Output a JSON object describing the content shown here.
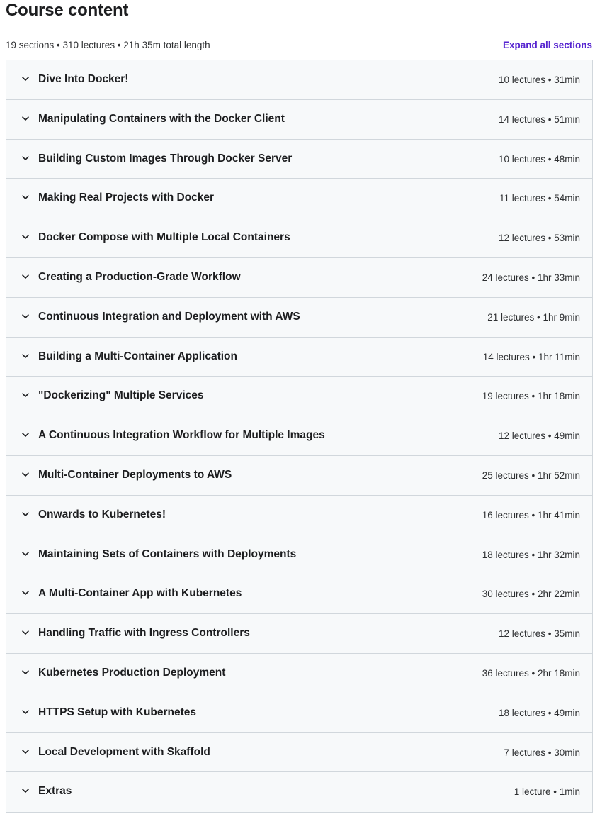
{
  "header": {
    "title": "Course content",
    "summary": "19 sections • 310 lectures • 21h 35m total length",
    "expand_label": "Expand all sections"
  },
  "icons": {
    "section_toggle": "chevron-down-icon"
  },
  "colors": {
    "accent": "#5624d0",
    "section_bg": "#f7f9fa",
    "border": "#d1d7dc",
    "text": "#1c1d1f"
  },
  "sections": [
    {
      "title": "Dive Into Docker!",
      "meta": "10 lectures • 31min"
    },
    {
      "title": "Manipulating Containers with the Docker Client",
      "meta": "14 lectures • 51min"
    },
    {
      "title": "Building Custom Images Through Docker Server",
      "meta": "10 lectures • 48min"
    },
    {
      "title": "Making Real Projects with Docker",
      "meta": "11 lectures • 54min"
    },
    {
      "title": "Docker Compose with Multiple Local Containers",
      "meta": "12 lectures • 53min"
    },
    {
      "title": "Creating a Production-Grade Workflow",
      "meta": "24 lectures • 1hr 33min"
    },
    {
      "title": "Continuous Integration and Deployment with AWS",
      "meta": "21 lectures • 1hr 9min"
    },
    {
      "title": "Building a Multi-Container Application",
      "meta": "14 lectures • 1hr 11min"
    },
    {
      "title": "\"Dockerizing\" Multiple Services",
      "meta": "19 lectures • 1hr 18min"
    },
    {
      "title": "A Continuous Integration Workflow for Multiple Images",
      "meta": "12 lectures • 49min"
    },
    {
      "title": "Multi-Container Deployments to AWS",
      "meta": "25 lectures • 1hr 52min"
    },
    {
      "title": "Onwards to Kubernetes!",
      "meta": "16 lectures • 1hr 41min"
    },
    {
      "title": "Maintaining Sets of Containers with Deployments",
      "meta": "18 lectures • 1hr 32min"
    },
    {
      "title": "A Multi-Container App with Kubernetes",
      "meta": "30 lectures • 2hr 22min"
    },
    {
      "title": "Handling Traffic with Ingress Controllers",
      "meta": "12 lectures • 35min"
    },
    {
      "title": "Kubernetes Production Deployment",
      "meta": "36 lectures • 2hr 18min"
    },
    {
      "title": "HTTPS Setup with Kubernetes",
      "meta": "18 lectures • 49min"
    },
    {
      "title": "Local Development with Skaffold",
      "meta": "7 lectures • 30min"
    },
    {
      "title": "Extras",
      "meta": "1 lecture • 1min"
    }
  ]
}
